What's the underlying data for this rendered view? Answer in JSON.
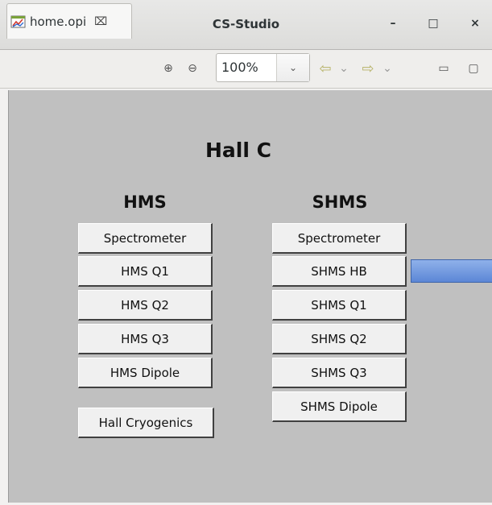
{
  "window": {
    "title": "CS-Studio",
    "minimize_icon": "–",
    "maximize_icon": "□",
    "close_icon": "×"
  },
  "toolbar": {
    "tab_label": "home.opi",
    "tab_close_icon": "⌧",
    "zoom_in_icon": "⊕",
    "zoom_out_icon": "⊖",
    "zoom_value": "100%",
    "zoom_dropdown_icon": "⌄",
    "back_icon": "⇦",
    "back_dropdown_icon": "⌄",
    "forward_icon": "⇨",
    "forward_dropdown_icon": "⌄",
    "view_minimize_icon": "▭",
    "view_maximize_icon": "▢"
  },
  "display": {
    "title": "Hall C",
    "hms": {
      "heading": "HMS",
      "buttons": [
        "Spectrometer",
        "HMS Q1",
        "HMS Q2",
        "HMS Q3",
        "HMS Dipole"
      ]
    },
    "shms": {
      "heading": "SHMS",
      "buttons": [
        "Spectrometer",
        "SHMS HB",
        "SHMS Q1",
        "SHMS Q2",
        "SHMS Q3",
        "SHMS Dipole"
      ]
    },
    "cryo_button": "Hall Cryogenics",
    "canvas_color": "#c0c0c0",
    "indicator_color": "#6b93dc"
  }
}
